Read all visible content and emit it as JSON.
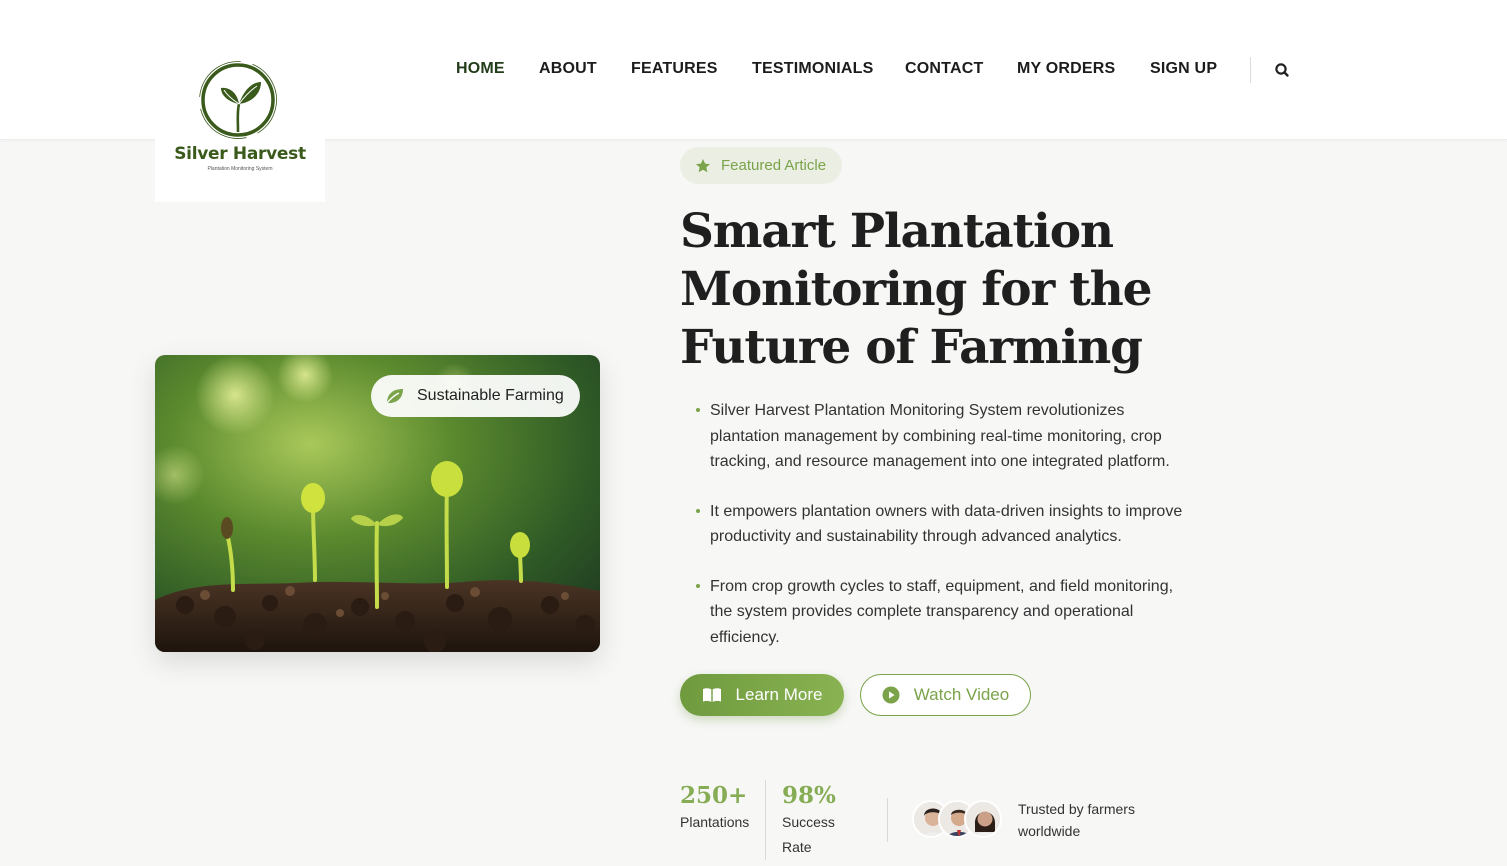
{
  "brand": {
    "name": "Silver Harvest",
    "tagline": "Plantation Monitoring System",
    "color": "#3a5a1c"
  },
  "nav": {
    "items": [
      {
        "label": "HOME"
      },
      {
        "label": "ABOUT"
      },
      {
        "label": "FEATURES"
      },
      {
        "label": "TESTIMONIALS"
      },
      {
        "label": "CONTACT"
      },
      {
        "label": "MY ORDERS"
      },
      {
        "label": "SIGN UP"
      }
    ],
    "active": "HOME",
    "search_icon": "search-icon"
  },
  "hero_image": {
    "tag_label": "Sustainable Farming",
    "tag_icon": "leaf-icon"
  },
  "hero": {
    "badge_label": "Featured Article",
    "badge_icon": "star-icon",
    "title": "Smart Plantation Monitoring for the Future of Farming",
    "bullets": [
      "Silver Harvest Plantation Monitoring System revolutionizes plantation management by combining real-time monitoring, crop tracking, and resource management into one integrated platform.",
      "It empowers plantation owners with data-driven insights to improve productivity and sustainability through advanced analytics.",
      "From crop growth cycles to staff, equipment, and field monitoring, the system provides complete transparency and operational efficiency."
    ],
    "primary_button": {
      "label": "Learn More",
      "icon": "book-icon"
    },
    "secondary_button": {
      "label": "Watch Video",
      "icon": "play-icon"
    }
  },
  "stats": {
    "items": [
      {
        "value": "250+",
        "label": "Plantations"
      },
      {
        "value": "98%",
        "label": "Success Rate"
      }
    ],
    "trusted_text": "Trusted by farmers worldwide"
  },
  "colors": {
    "accent": "#7aa34a",
    "accent_dark": "#6f9a3e",
    "text": "#1f1f1f",
    "background": "#f7f7f6"
  }
}
